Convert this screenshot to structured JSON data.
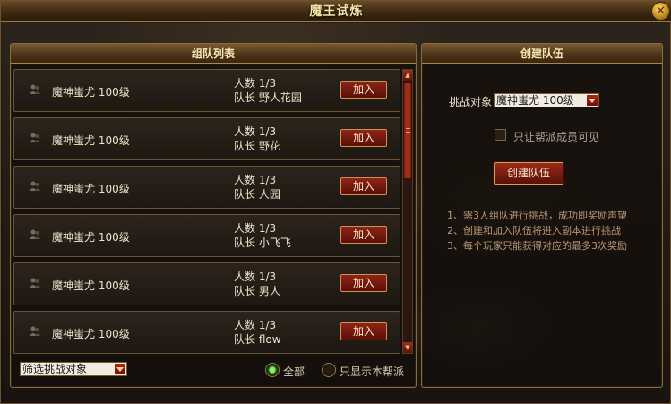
{
  "window": {
    "title": "魔王试炼",
    "close_label": "✕"
  },
  "left_panel": {
    "title": "组队列表",
    "rows": [
      {
        "boss": "魔神蚩尤 100级",
        "count": "人数 1/3",
        "leader": "队长 野人花园",
        "join": "加入"
      },
      {
        "boss": "魔神蚩尤 100级",
        "count": "人数 1/3",
        "leader": "队长 野花",
        "join": "加入"
      },
      {
        "boss": "魔神蚩尤 100级",
        "count": "人数 1/3",
        "leader": "队长 人园",
        "join": "加入"
      },
      {
        "boss": "魔神蚩尤 100级",
        "count": "人数 1/3",
        "leader": "队长 小飞飞",
        "join": "加入"
      },
      {
        "boss": "魔神蚩尤 100级",
        "count": "人数 1/3",
        "leader": "队长 男人",
        "join": "加入"
      },
      {
        "boss": "魔神蚩尤 100级",
        "count": "人数 1/3",
        "leader": "队长 flow",
        "join": "加入"
      }
    ],
    "filter_select": "筛选挑战对象",
    "radio_all": "全部",
    "radio_guild": "只显示本帮派",
    "radio_selected": "all"
  },
  "right_panel": {
    "title": "创建队伍",
    "target_label": "挑战对象",
    "target_value": "魔神蚩尤 100级",
    "checkbox_label": "只让帮派成员可见",
    "checkbox_checked": false,
    "create_button": "创建队伍",
    "tips": [
      "1、需3人组队进行挑战，成功即奖励声望",
      "2、创建和加入队伍将进入副本进行挑战",
      "3、每个玩家只能获得对应的最多3次奖励"
    ]
  },
  "icons": [
    "person-icon",
    "close-icon",
    "dropdown-arrow-icon",
    "scroll-up-icon",
    "scroll-down-icon"
  ],
  "colors": {
    "accent_gold": "#f4e2a8",
    "button_red": "#8e2418",
    "radio_on": "#8aee6a"
  }
}
